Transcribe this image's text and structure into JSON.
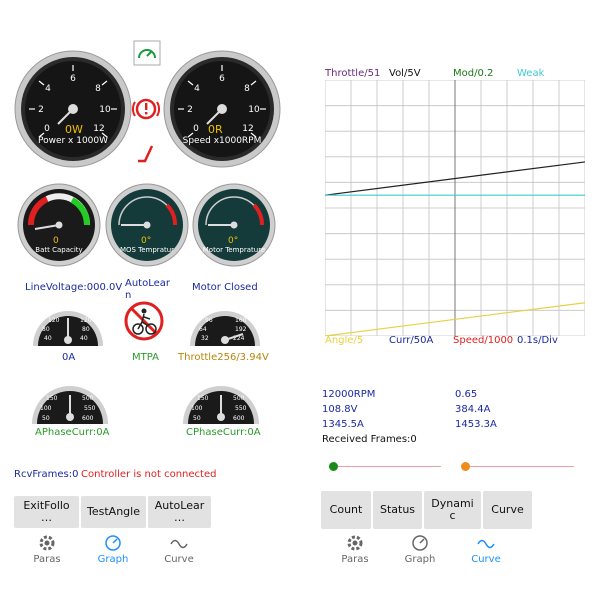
{
  "gauges": {
    "power": {
      "value": "0W",
      "caption": "Power x 1000W",
      "ticks": [
        "0",
        "2",
        "4",
        "6",
        "8",
        "10",
        "12"
      ]
    },
    "speed": {
      "value": "0R",
      "caption": "Speed x1000RPM",
      "ticks": [
        "0",
        "2",
        "4",
        "6",
        "8",
        "10",
        "12"
      ]
    },
    "batt": {
      "value": "0",
      "caption": "Batt Capacity"
    },
    "mos": {
      "value": "0°",
      "caption": "MOS Tempratur"
    },
    "motor": {
      "value": "0°",
      "caption": "Motor Temprature"
    }
  },
  "status": {
    "line_voltage": "LineVoltage:000.0V",
    "auto_learn": "AutoLear\nn",
    "motor_closed": "Motor Closed",
    "current_a": "0A",
    "mtpa": "MTPA",
    "throttle": "Throttle256/3.94V",
    "a_phase": "APhaseCurr:0A",
    "c_phase": "CPhaseCurr:0A",
    "rcv_frames": "RcvFrames:0",
    "controller_status": "Controller is not connected"
  },
  "left_buttons": {
    "exit_follow": "ExitFollo\n…",
    "test_angle": "TestAngle",
    "auto_learn": "AutoLear\n…"
  },
  "left_nav": {
    "paras": "Paras",
    "graph": "Graph",
    "curve": "Curve"
  },
  "chart_legend": {
    "throttle": "Throttle/51",
    "vol": "Vol/5V",
    "mod": "Mod/0.2",
    "weak": "Weak",
    "angle": "Angle/5",
    "curr": "Curr/50A",
    "speed": "Speed/1000",
    "div": "0.1s/Div"
  },
  "chart_colors": {
    "throttle": "#6a2a7a",
    "vol": "#111111",
    "mod": "#1a7a1a",
    "weak": "#40c8d8",
    "angle": "#e8d040",
    "curr": "#1a2aa0",
    "speed": "#e02020",
    "div": "#1a2aa0"
  },
  "chart_data": {
    "type": "line",
    "x": [
      0,
      1
    ],
    "series": [
      {
        "color": "#222222",
        "values": [
          0.55,
          0.68
        ]
      },
      {
        "color": "#40c8d8",
        "values": [
          0.55,
          0.55
        ]
      },
      {
        "color": "#e8d040",
        "values": [
          0.0,
          0.13
        ]
      }
    ],
    "ylim": [
      0,
      1
    ],
    "grid": true
  },
  "readouts": {
    "rpm": "12000RPM",
    "v1": "0.65",
    "volts": "108.8V",
    "v2": "384.4A",
    "amp1": "1345.5A",
    "amp2": "1453.3A",
    "received": "Received Frames:0"
  },
  "right_buttons": {
    "count": "Count",
    "status": "Status",
    "dynamic": "Dynami\nc",
    "curve": "Curve"
  },
  "right_nav": {
    "paras": "Paras",
    "graph": "Graph",
    "curve": "Curve"
  },
  "colors": {
    "slider_green": "#1a8a1a",
    "slider_orange": "#f08a1a",
    "active_nav": "#1e90ff"
  }
}
